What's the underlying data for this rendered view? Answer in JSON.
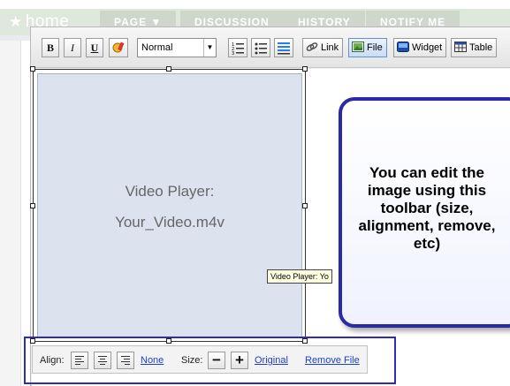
{
  "nav": {
    "home_label": "home",
    "tabs": [
      "PAGE ▼",
      "DISCUSSION",
      "HISTORY",
      "NOTIFY ME"
    ]
  },
  "toolbar": {
    "bold": "B",
    "italic": "I",
    "underline": "U",
    "format_value": "Normal",
    "link_label": "Link",
    "file_label": "File",
    "widget_label": "Widget",
    "table_label": "Table"
  },
  "video": {
    "title": "Video Player:",
    "filename": "Your_Video.m4v"
  },
  "tooltip": "Video Player: Yo",
  "callout": "You can edit the image using this toolbar (size, alignment, remove, etc)",
  "image_toolbar": {
    "align_label": "Align:",
    "none_link": "None",
    "size_label": "Size:",
    "minus": "−",
    "plus": "+",
    "original_link": "Original",
    "remove_link": "Remove File"
  },
  "colors": {
    "callout_border": "#2a2aa6",
    "highlight_border": "#2d2dbd",
    "link": "#1a3fd1",
    "video_bg": "#dde2ef"
  }
}
